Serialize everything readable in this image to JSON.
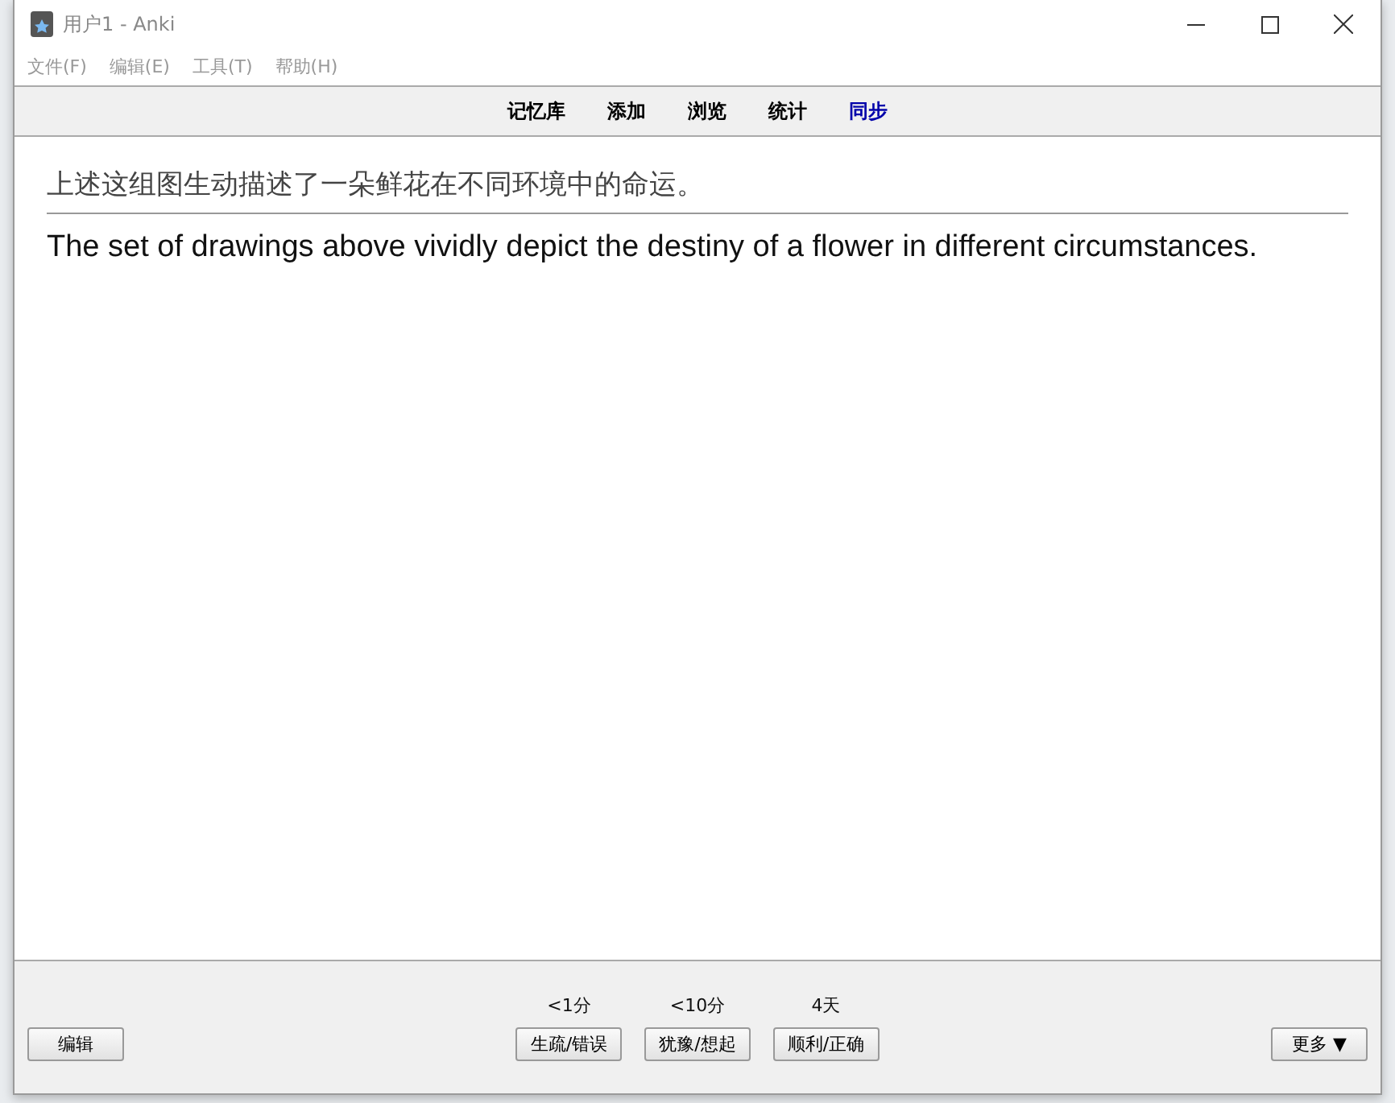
{
  "window": {
    "title": "用户1 - Anki"
  },
  "menu": [
    "文件(F)",
    "编辑(E)",
    "工具(T)",
    "帮助(H)"
  ],
  "toolbar": [
    {
      "label": "记忆库",
      "color": "#000000"
    },
    {
      "label": "添加",
      "color": "#000000"
    },
    {
      "label": "浏览",
      "color": "#000000"
    },
    {
      "label": "统计",
      "color": "#000000"
    },
    {
      "label": "同步",
      "color": "#0000aa"
    }
  ],
  "card": {
    "question": "上述这组图生动描述了一朵鲜花在不同环境中的命运。",
    "answer": "The set of drawings above vividly depict the destiny of a flower in different circumstances."
  },
  "bottom": {
    "edit": "编辑",
    "more": "更多 ▼",
    "answers": [
      {
        "interval": "<1分",
        "label": "生疏/错误"
      },
      {
        "interval": "<10分",
        "label": "犹豫/想起"
      },
      {
        "interval": "4天",
        "label": "顺利/正确"
      }
    ]
  }
}
